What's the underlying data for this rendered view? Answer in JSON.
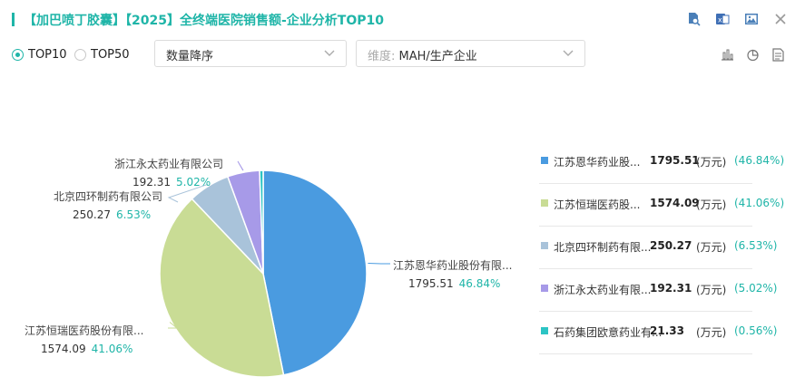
{
  "header": {
    "title": "【加巴喷丁胶囊】【2025】全终端医院销售额-企业分析TOP10",
    "accent_color": "#1fb5a8",
    "icons": [
      "search-file-icon",
      "excel-export-icon",
      "image-export-icon",
      "close-icon"
    ]
  },
  "controls": {
    "top10_label": "TOP10",
    "top50_label": "TOP50",
    "selected": "TOP10",
    "sort_select": "数量降序",
    "dimension_prefix": "维度:",
    "dimension_value": "MAH/生产企业",
    "view_icons": [
      "bar-chart-icon",
      "pie-chart-icon",
      "document-icon"
    ]
  },
  "chart_data": {
    "type": "pie",
    "unit": "(万元)",
    "slices": [
      {
        "name": "江苏恩华药业股份有限...",
        "legend_name": "江苏恩华药业股...",
        "value": 1795.51,
        "value_text": "1795.51",
        "pct": "46.84%",
        "pct_text": "(46.84%)",
        "color": "#4a9be0"
      },
      {
        "name": "江苏恒瑞医药股份有限...",
        "legend_name": "江苏恒瑞医药股...",
        "value": 1574.09,
        "value_text": "1574.09",
        "pct": "41.06%",
        "pct_text": "(41.06%)",
        "color": "#c9dc95"
      },
      {
        "name": "北京四环制药有限公司",
        "legend_name": "北京四环制药有限...",
        "value": 250.27,
        "value_text": "250.27",
        "pct": "6.53%",
        "pct_text": "(6.53%)",
        "color": "#a9c3da"
      },
      {
        "name": "浙江永太药业有限公司",
        "legend_name": "浙江永太药业有限...",
        "value": 192.31,
        "value_text": "192.31",
        "pct": "5.02%",
        "pct_text": "(5.02%)",
        "color": "#a79ae8"
      },
      {
        "name": "石药集团欧意药业有...",
        "legend_name": "石药集团欧意药业有...",
        "value": 21.33,
        "value_text": "21.33",
        "pct": "0.56%",
        "pct_text": "(0.56%)",
        "color": "#2cc4c4"
      }
    ]
  }
}
